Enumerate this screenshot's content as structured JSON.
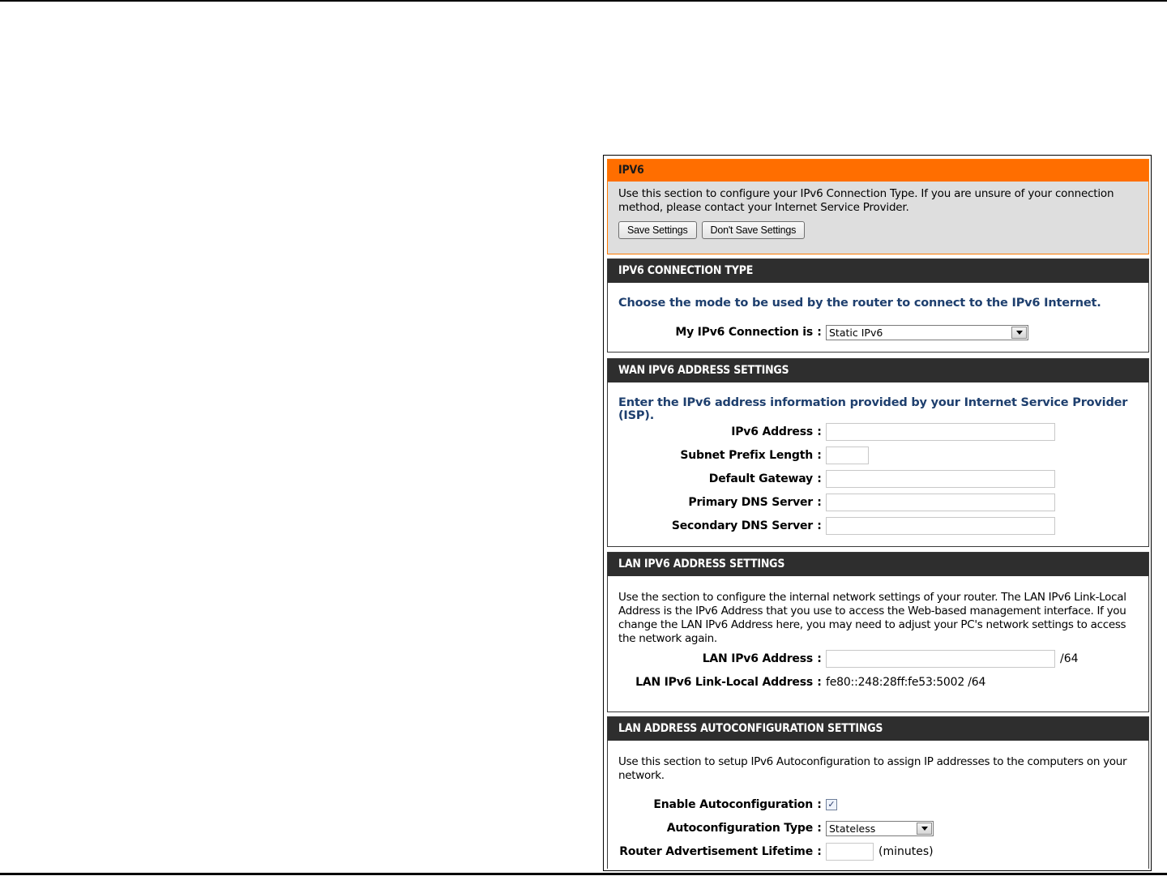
{
  "intro": {
    "title": "IPV6",
    "text": "Use this section to configure your IPv6 Connection Type. If you are unsure of your connection method, please contact your Internet Service Provider.",
    "save_label": "Save Settings",
    "dont_save_label": "Don't Save Settings"
  },
  "connection_type": {
    "title": "IPV6 CONNECTION TYPE",
    "note": "Choose the mode to be used by the router to connect to the IPv6 Internet.",
    "label": "My IPv6 Connection is",
    "selected": "Static IPv6"
  },
  "wan": {
    "title": "WAN IPV6 ADDRESS SETTINGS",
    "note": "Enter the IPv6 address information provided by your Internet Service Provider (ISP).",
    "ipv6_address_label": "IPv6 Address",
    "ipv6_address_value": "",
    "subnet_prefix_label": "Subnet Prefix Length",
    "subnet_prefix_value": "",
    "gateway_label": "Default Gateway",
    "gateway_value": "",
    "primary_dns_label": "Primary DNS Server",
    "primary_dns_value": "",
    "secondary_dns_label": "Secondary DNS Server",
    "secondary_dns_value": ""
  },
  "lan": {
    "title": "LAN IPV6 ADDRESS SETTINGS",
    "text": "Use the section to configure the internal network settings of your router. The LAN IPv6 Link-Local Address is the IPv6 Address that you use to access the Web-based management interface. If you change the LAN IPv6 Address here, you may need to adjust your PC's network settings to access the network again.",
    "lan_address_label": "LAN IPv6 Address",
    "lan_address_value": "",
    "lan_address_suffix": "/64",
    "link_local_label": "LAN IPv6 Link-Local Address",
    "link_local_value": "fe80::248:28ff:fe53:5002 /64"
  },
  "autoconf": {
    "title": "LAN ADDRESS AUTOCONFIGURATION SETTINGS",
    "text": "Use this section to setup IPv6 Autoconfiguration to assign IP addresses to the computers on your network.",
    "enable_label": "Enable Autoconfiguration",
    "enable_checked": true,
    "enable_check_glyph": "✓",
    "type_label": "Autoconfiguration Type",
    "type_selected": "Stateless",
    "lifetime_label": "Router Advertisement Lifetime",
    "lifetime_value": "",
    "lifetime_suffix": "(minutes)"
  },
  "colon": ":",
  "colors": {
    "orange_header": "#ff6e00",
    "dark_header": "#2e2e2e",
    "note_blue": "#1e3f6e",
    "intro_bg": "#dedede"
  }
}
